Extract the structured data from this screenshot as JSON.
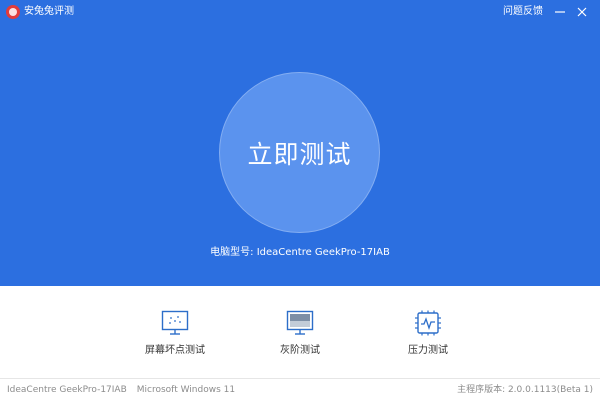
{
  "app": {
    "title": "安兔兔评测",
    "feedback_label": "问题反馈",
    "minimize_icon": "minimize-icon",
    "close_icon": "close-icon"
  },
  "main": {
    "start_button_label": "立即测试",
    "model_label": "电脑型号:",
    "model_value": "IdeaCentre GeekPro-17IAB"
  },
  "tools": [
    {
      "label": "屏幕坏点测试",
      "icon": "monitor-dots-icon"
    },
    {
      "label": "灰阶测试",
      "icon": "monitor-grayscale-icon"
    },
    {
      "label": "压力测试",
      "icon": "chip-pulse-icon"
    }
  ],
  "status": {
    "device": "IdeaCentre GeekPro-17IAB",
    "os": "Microsoft Windows 11",
    "version": "主程序版本: 2.0.0.1113(Beta 1)"
  },
  "colors": {
    "header_blue": "#2c6fe0",
    "button_circle": "#5b93ee",
    "icon_blue": "#2d6ec9"
  }
}
